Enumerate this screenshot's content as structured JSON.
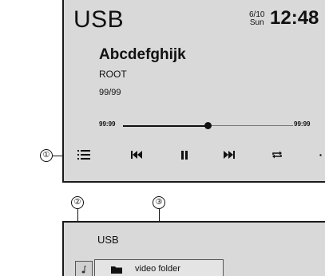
{
  "player": {
    "source": "USB",
    "date_line1": "6/10",
    "date_line2": "Sun",
    "time": "12:48",
    "track_title": "Abcdefghijk",
    "folder": "ROOT",
    "track_count": "99/99",
    "elapsed": "99:99",
    "remaining": "99:99",
    "progress": 0.5
  },
  "controls": [
    {
      "name": "list-button",
      "icon": "list-icon"
    },
    {
      "name": "previous-track-button",
      "icon": "skip-previous-icon"
    },
    {
      "name": "pause-button",
      "icon": "pause-icon"
    },
    {
      "name": "next-track-button",
      "icon": "skip-next-icon"
    },
    {
      "name": "repeat-button",
      "icon": "repeat-icon"
    }
  ],
  "callouts": [
    "①",
    "②",
    "③"
  ],
  "browser": {
    "title": "USB",
    "items": [
      {
        "label": "video folder",
        "icon": "folder-icon"
      }
    ],
    "tab_icon": "music-note-icon"
  }
}
